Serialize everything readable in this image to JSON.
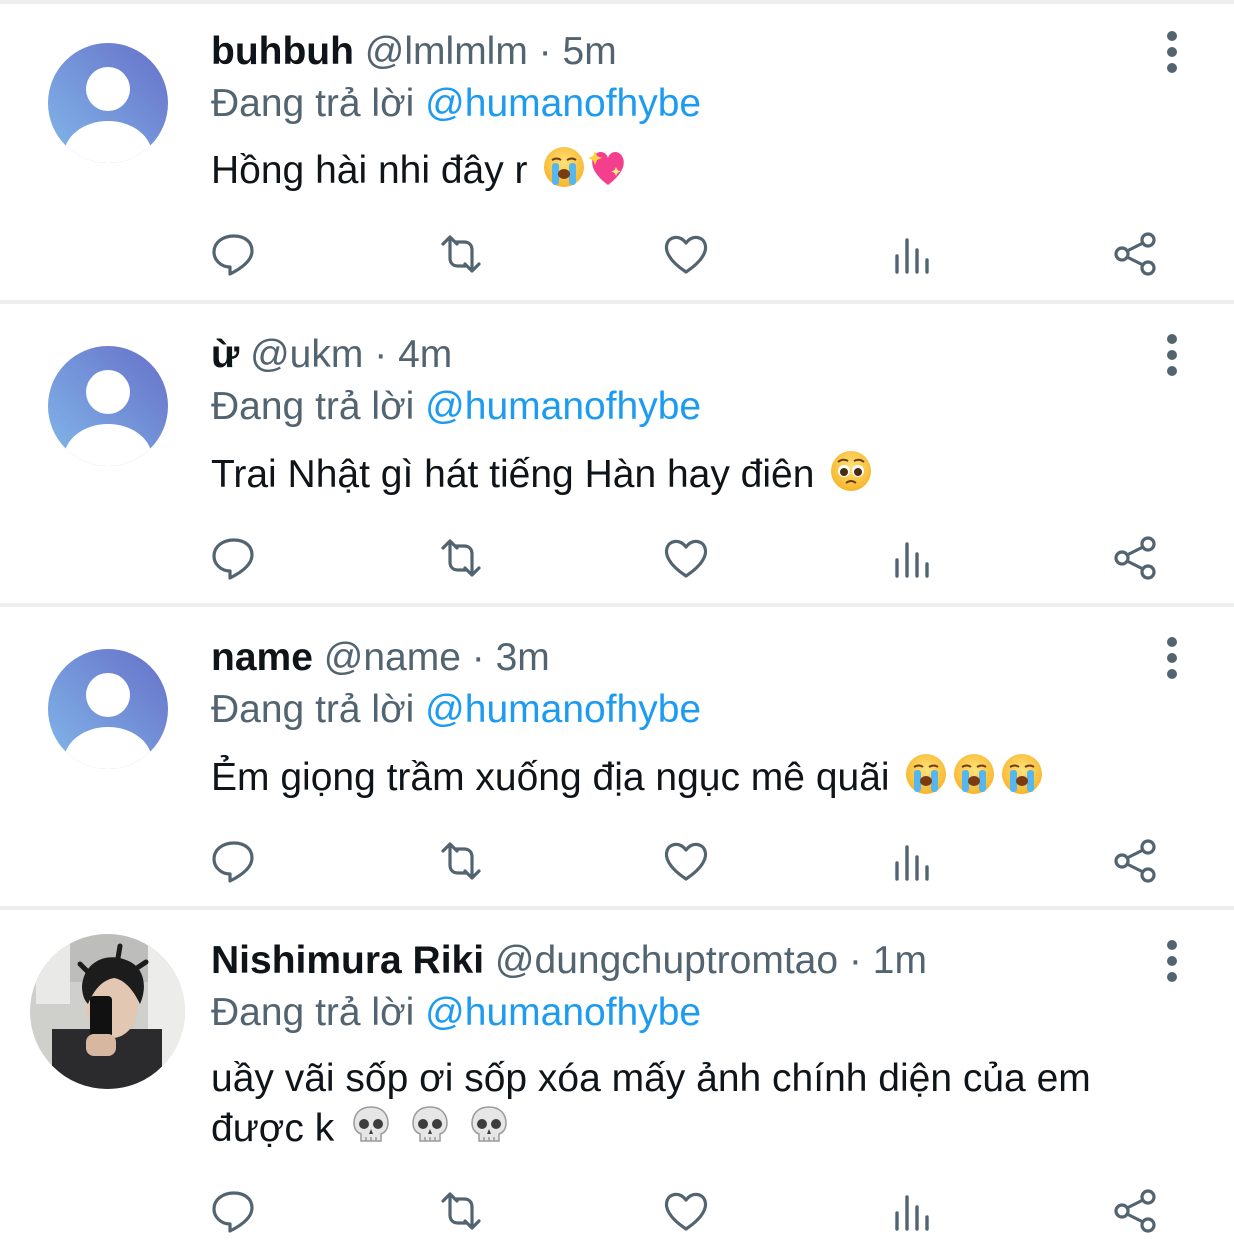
{
  "tweets": [
    {
      "name": "buhbuh",
      "handle": "@lmlmlm",
      "separator": "·",
      "time": "5m",
      "reply_prefix": "Đang trả lời",
      "reply_to": "@humanofhybe",
      "text": "Hồng hài nhi đây r",
      "emojis": [
        "crying-face",
        "sparkling-heart"
      ],
      "avatar": "default-avatar"
    },
    {
      "name": "ừ",
      "handle": "@ukm",
      "separator": "·",
      "time": "4m",
      "reply_prefix": "Đang trả lời",
      "reply_to": "@humanofhybe",
      "text": "Trai Nhật gì hát tiếng Hàn hay điên",
      "emojis": [
        "pleading-face"
      ],
      "avatar": "default-avatar"
    },
    {
      "name": "name",
      "handle": "@name",
      "separator": "·",
      "time": "3m",
      "reply_prefix": "Đang trả lời",
      "reply_to": "@humanofhybe",
      "text": "Ẻm giọng trầm xuống địa ngục mê quãi",
      "emojis": [
        "crying-face",
        "crying-face",
        "crying-face"
      ],
      "avatar": "default-avatar"
    },
    {
      "name": "Nishimura Riki",
      "handle": "@dungchuptromtao",
      "separator": "·",
      "time": "1m",
      "reply_prefix": "Đang trả lời",
      "reply_to": "@humanofhybe",
      "text_line1": "uầy vãi sốp ơi sốp xóa mấy ảnh chính diện của em",
      "text_line2": "được k",
      "emojis": [
        "skull",
        "skull",
        "skull"
      ],
      "avatar": "mirror-selfie-photo"
    }
  ],
  "action_icons": [
    "reply-icon",
    "retweet-icon",
    "like-icon",
    "analytics-icon",
    "share-icon"
  ],
  "more_icon": "more-options-icon",
  "colors": {
    "link": "#1d9bf0",
    "secondary_text": "#536471",
    "primary_text": "#0f1419",
    "separator": "#eceef0",
    "avatar_gradient_start": "#7fb3e8",
    "avatar_gradient_end": "#6a72c9"
  }
}
